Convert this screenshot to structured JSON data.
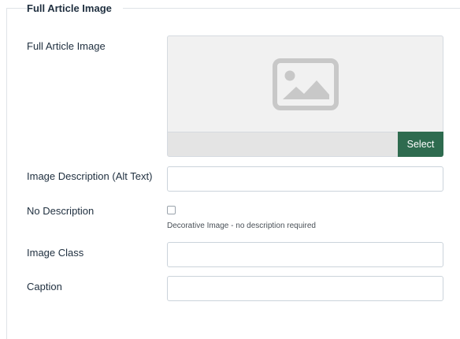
{
  "fieldset": {
    "legend": "Full Article Image"
  },
  "fields": {
    "full_image": {
      "label": "Full Article Image",
      "select_label": "Select",
      "icon": "image-placeholder-icon"
    },
    "alt_text": {
      "label": "Image Description (Alt Text)",
      "value": ""
    },
    "no_description": {
      "label": "No Description",
      "checked": false,
      "hint": "Decorative Image - no description required"
    },
    "image_class": {
      "label": "Image Class",
      "value": ""
    },
    "caption": {
      "label": "Caption",
      "value": ""
    }
  },
  "colors": {
    "select_button": "#2e6b4f",
    "preview_background": "#f1f1f1",
    "placeholder_icon": "#c8c8c8"
  }
}
